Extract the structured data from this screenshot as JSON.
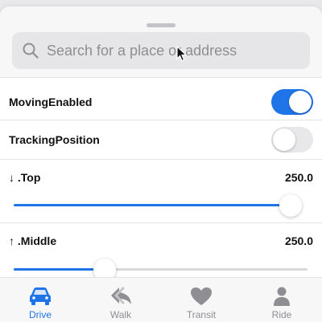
{
  "search": {
    "placeholder": "Search for a place or address"
  },
  "settings": {
    "moving_enabled": {
      "label": "MovingEnabled",
      "value": true
    },
    "tracking_position": {
      "label": "TrackingPosition",
      "value": false
    },
    "top": {
      "label": "↓ .Top",
      "value": "250.0",
      "slider_fraction": 0.97
    },
    "middle": {
      "label": "↑ .Middle",
      "value": "250.0",
      "slider_fraction": 0.31
    }
  },
  "tabs": [
    {
      "label": "Drive",
      "icon": "car-icon",
      "active": true
    },
    {
      "label": "Walk",
      "icon": "walk-icon",
      "active": false
    },
    {
      "label": "Transit",
      "icon": "heart-icon",
      "active": false
    },
    {
      "label": "Ride",
      "icon": "person-icon",
      "active": false
    }
  ],
  "colors": {
    "accent": "#1f74e8",
    "inactive": "#8e8e93"
  }
}
